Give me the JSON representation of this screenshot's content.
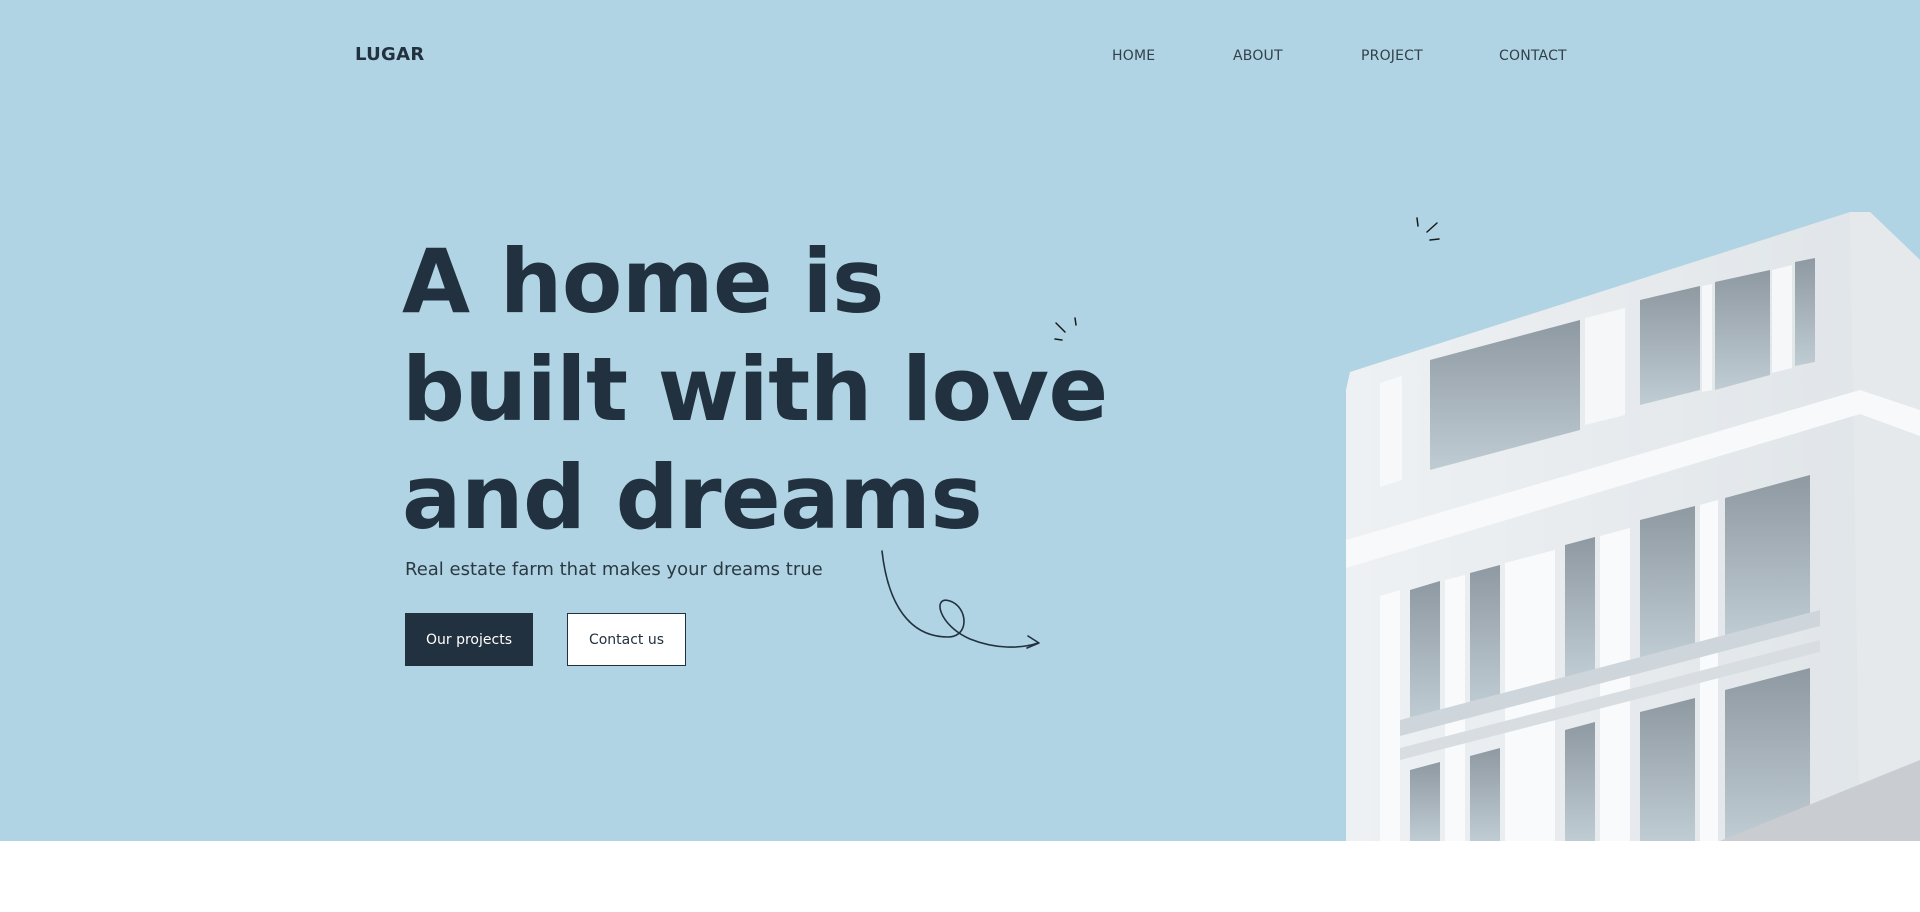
{
  "brand": {
    "logo": "LUGAR"
  },
  "nav": {
    "items": [
      {
        "label": "HOME"
      },
      {
        "label": "ABOUT"
      },
      {
        "label": "PROJECT"
      },
      {
        "label": "CONTACT"
      }
    ]
  },
  "hero": {
    "headline_lines": [
      "A home is",
      "built with love",
      "and dreams"
    ],
    "subtitle": "Real estate farm that makes your dreams true",
    "primary_button": "Our projects",
    "secondary_button": "Contact us"
  },
  "colors": {
    "hero_background": "#b0d4e3",
    "text_dark": "#22313f",
    "button_primary_bg": "#22313f",
    "page_background": "#ffffff"
  },
  "icons": [
    "sparkle-icon",
    "curly-arrow-icon"
  ]
}
